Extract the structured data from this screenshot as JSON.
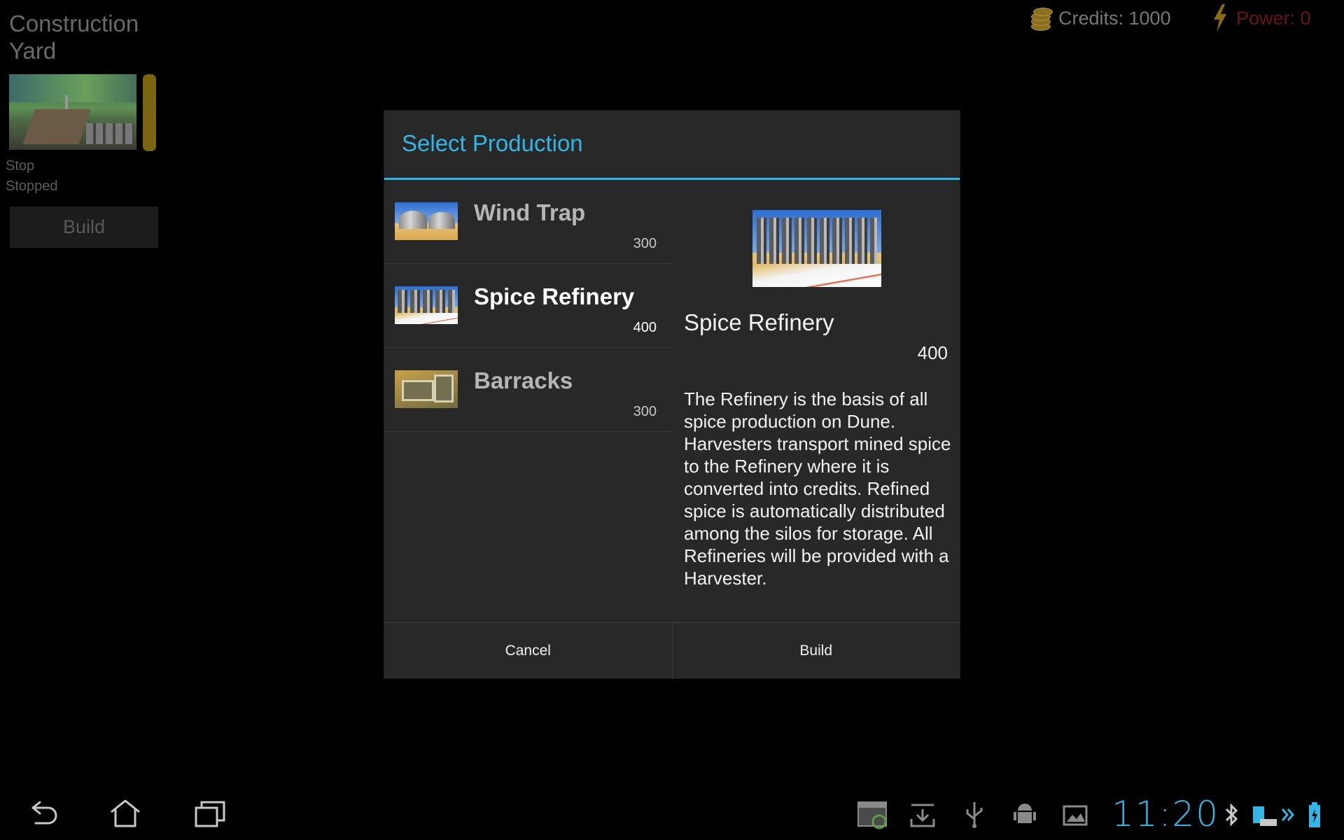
{
  "structure": {
    "title": "Construction Yard",
    "status_action": "Stop",
    "status_state": "Stopped",
    "build_label": "Build"
  },
  "resources": {
    "credits_label": "Credits: 1000",
    "power_label": "Power: 0",
    "power_color": "#6a1515",
    "credits_icon": "coins-icon",
    "power_icon": "lightning-bolt-icon"
  },
  "dialog": {
    "title": "Select Production",
    "accent_color": "#33b5e5",
    "items": [
      {
        "name": "Wind Trap",
        "cost": "300",
        "selected": false
      },
      {
        "name": "Spice Refinery",
        "cost": "400",
        "selected": true
      },
      {
        "name": "Barracks",
        "cost": "300",
        "selected": false
      }
    ],
    "detail": {
      "name": "Spice Refinery",
      "cost": "400",
      "description": "The Refinery is the basis of all spice production on Dune. Harvesters transport mined spice to the Refinery where it is converted into credits. Refined spice is automatically distributed among the silos for storage. All Refineries will be provided with a Harvester."
    },
    "cancel_label": "Cancel",
    "build_label": "Build"
  },
  "navbar": {
    "back_icon": "back-icon",
    "home_icon": "home-icon",
    "recents_icon": "recent-apps-icon",
    "clock": "11:20"
  }
}
